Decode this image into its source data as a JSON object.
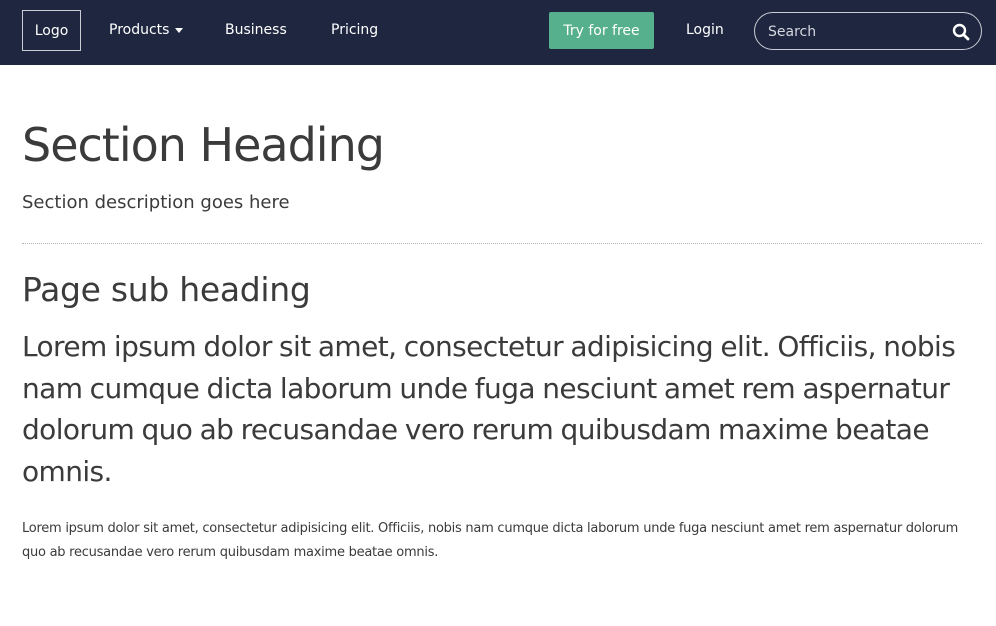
{
  "navbar": {
    "logo": "Logo",
    "products": "Products",
    "business": "Business",
    "pricing": "Pricing",
    "try_for_free": "Try for free",
    "login": "Login",
    "search_placeholder": "Search"
  },
  "colors": {
    "navbar_bg": "#1f2740",
    "cta_green": "#56b08d",
    "text": "#3b3b3b"
  },
  "main": {
    "section_heading": "Section Heading",
    "section_description": "Section description goes here",
    "page_sub_heading": "Page sub heading",
    "lead_paragraph": "Lorem ipsum dolor sit amet, consectetur adipisicing elit. Officiis, nobis nam cumque dicta laborum unde fuga nesciunt amet rem aspernatur dolorum quo ab recusandae vero rerum quibusdam maxime beatae omnis.",
    "body_paragraph": "Lorem ipsum dolor sit amet, consectetur adipisicing elit. Officiis, nobis nam cumque dicta laborum unde fuga nesciunt amet rem aspernatur dolorum quo ab recusandae vero rerum quibusdam maxime beatae omnis."
  }
}
